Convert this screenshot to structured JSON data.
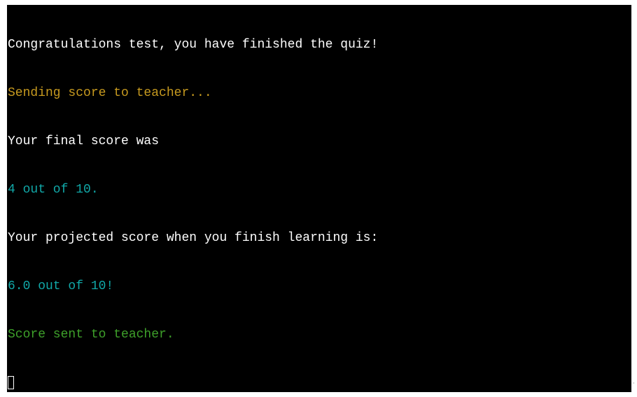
{
  "terminal": {
    "lines": [
      {
        "text": "Congratulations test, you have finished the quiz!",
        "color": "#ffffff"
      },
      {
        "text": "Sending score to teacher...",
        "color": "#c79a1f"
      },
      {
        "text": "Your final score was",
        "color": "#ffffff"
      },
      {
        "text": "4 out of 10.",
        "color": "#11a8a8"
      },
      {
        "text": "Your projected score when you finish learning is:",
        "color": "#ffffff"
      },
      {
        "text": "6.0 out of 10!",
        "color": "#11a8a8"
      },
      {
        "text": "Score sent to teacher.",
        "color": "#3ea02a"
      }
    ]
  }
}
